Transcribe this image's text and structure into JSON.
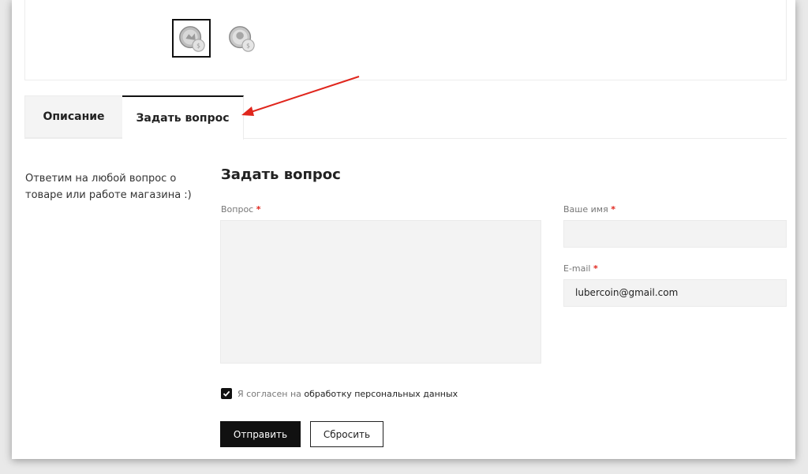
{
  "tabs": [
    {
      "label": "Описание"
    },
    {
      "label": "Задать вопрос"
    }
  ],
  "side_note": "Ответим на любой вопрос о товаре или работе магазина :)",
  "form": {
    "title": "Задать вопрос",
    "question_label": "Вопрос",
    "name_label": "Ваше имя",
    "email_label": "E-mail",
    "required_mark": "*",
    "email_value": "lubercoin@gmail.com",
    "consent_prefix": "Я согласен на",
    "consent_link": "обработку персональных данных",
    "submit_label": "Отправить",
    "reset_label": "Сбросить"
  },
  "colors": {
    "accent": "#111111",
    "required": "#e0261d",
    "annotation_arrow": "#e0261d",
    "field_bg": "#f3f3f3"
  }
}
